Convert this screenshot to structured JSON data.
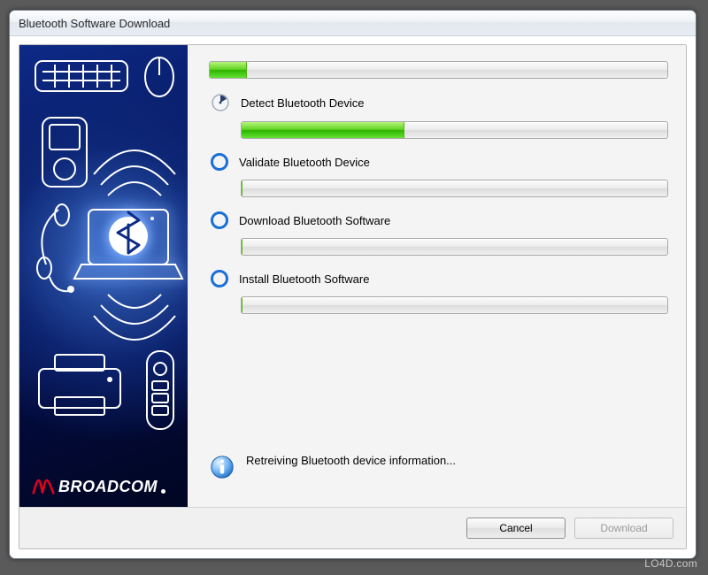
{
  "window": {
    "title": "Bluetooth Software Download"
  },
  "overall_progress": {
    "percent": 8
  },
  "steps": [
    {
      "id": "detect",
      "label": "Detect Bluetooth Device",
      "icon": "clock",
      "progress": 38
    },
    {
      "id": "validate",
      "label": "Validate Bluetooth Device",
      "icon": "ring",
      "progress": 0
    },
    {
      "id": "download",
      "label": "Download Bluetooth Software",
      "icon": "ring",
      "progress": 0
    },
    {
      "id": "install",
      "label": "Install Bluetooth Software",
      "icon": "ring",
      "progress": 0
    }
  ],
  "status": {
    "text": "Retreiving Bluetooth device information..."
  },
  "footer": {
    "cancel_label": "Cancel",
    "download_label": "Download"
  },
  "brand": {
    "name": "BROADCOM"
  },
  "watermark": "LO4D.com",
  "colors": {
    "accent_blue": "#1a6fd6",
    "progress_green": "#5fd21f",
    "brand_red": "#e2001a"
  }
}
